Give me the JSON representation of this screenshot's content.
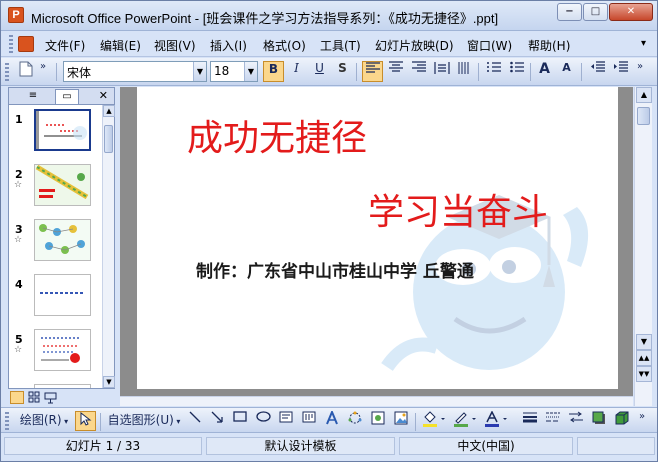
{
  "window": {
    "title": "Microsoft Office PowerPoint - [班会课件之学习方法指导系列：《成功无捷径》.ppt]",
    "app_icon_letter": "P",
    "minimize": "−",
    "maximize": "□",
    "close": "✕"
  },
  "menu": [
    "文件(F)",
    "编辑(E)",
    "视图(V)",
    "插入(I)",
    "格式(O)",
    "工具(T)",
    "幻灯片放映(D)",
    "窗口(W)",
    "帮助(H)"
  ],
  "formatting": {
    "font_name": "宋体",
    "font_size": "18",
    "bold": "B",
    "italic": "I",
    "underline": "U",
    "shadow": "S",
    "align_left": "≡",
    "increase_font": "A",
    "decrease_font": "A",
    "overflow_chevron": "»",
    "active_color": "#fbd78c"
  },
  "panel": {
    "tab_outline_icon": "≡",
    "tab_slides_icon": "▭",
    "close": "✕"
  },
  "slides": [
    {
      "num": "1",
      "star": ""
    },
    {
      "num": "2",
      "star": "☆"
    },
    {
      "num": "3",
      "star": "☆"
    },
    {
      "num": "4",
      "star": ""
    },
    {
      "num": "5",
      "star": "☆"
    }
  ],
  "slide": {
    "title": "成功无捷径",
    "subtitle": "学习当奋斗",
    "author": "制作：广东省中山市桂山中学  丘警通",
    "title_color": "#e31b1b",
    "author_color": "#1a1a1a"
  },
  "drawing": {
    "draw_label": "绘图(R)",
    "autoshapes_label": "自选图形(U)"
  },
  "status": {
    "slide_counter": "幻灯片 1 / 33",
    "design": "默认设计模板",
    "language": "中文(中国)"
  }
}
